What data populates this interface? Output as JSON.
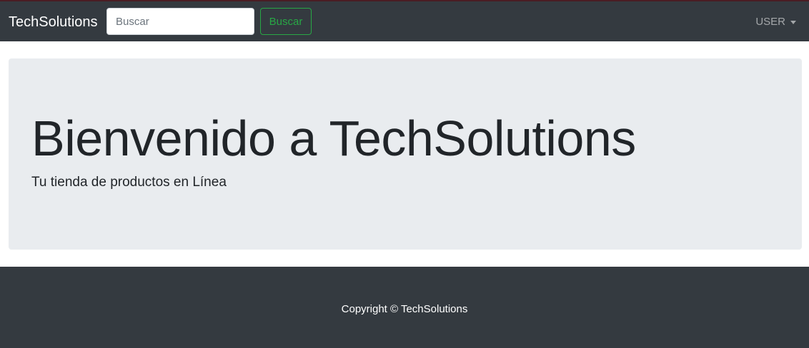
{
  "navbar": {
    "brand": "TechSolutions",
    "search_placeholder": "Buscar",
    "search_button": "Buscar",
    "user_menu": "USER"
  },
  "jumbotron": {
    "title": "Bienvenido a TechSolutions",
    "lead": "Tu tienda de productos en Línea"
  },
  "footer": {
    "copyright": "Copyright © TechSolutions"
  },
  "colors": {
    "navbar_bg": "#343a40",
    "jumbotron_bg": "#e9ecef",
    "success_outline": "#28a745"
  }
}
